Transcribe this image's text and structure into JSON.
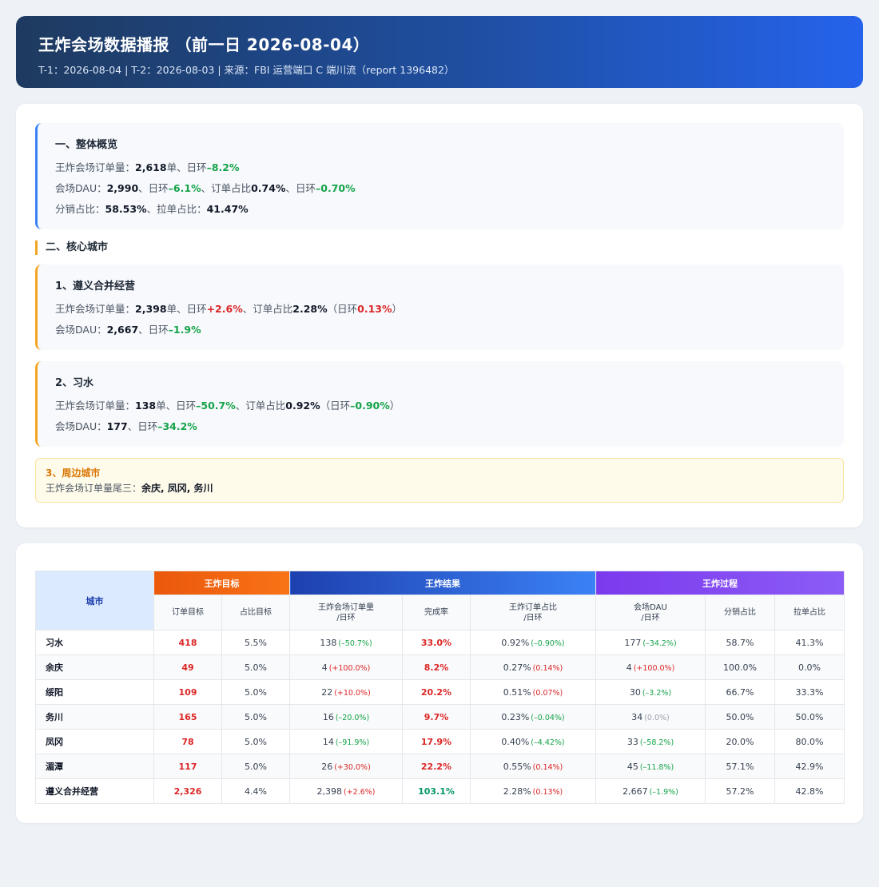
{
  "header": {
    "title": "王炸会场数据播报 （前一日 2026-08-04）",
    "subtitle": "T-1：2026-08-04 | T-2：2026-08-03 | 来源：FBI 运营端口 C 端川流（report 1396482）"
  },
  "overview": {
    "title": "一、整体概览",
    "orders_label": "王炸会场订单量：",
    "orders_value": "2,618",
    "orders_unit": "单、日环",
    "orders_change": "–8.2%",
    "dau_label": "会场DAU：",
    "dau_value": "2,990",
    "dau_sep": "、日环",
    "dau_change": "–6.1%",
    "share_label": "、订单占比",
    "share_value": "0.74%",
    "share_sep": "、日环",
    "share_change": "–0.70%",
    "dist_label": "分销占比：",
    "dist_value": "58.53%",
    "pull_label": "、拉单占比：",
    "pull_value": "41.47%"
  },
  "core": {
    "title": "二、核心城市",
    "c1": {
      "title": "1、遵义合并经营",
      "orders_label": "王炸会场订单量：",
      "orders_value": "2,398",
      "orders_unit": "单、日环",
      "orders_change": "+2.6%",
      "share_label": "、订单占比",
      "share_value": "2.28%",
      "share_open": "（日环",
      "share_change": "0.13%",
      "share_close": "）",
      "dau_label": "会场DAU：",
      "dau_value": "2,667",
      "dau_sep": "、日环",
      "dau_change": "–1.9%"
    },
    "c2": {
      "title": "2、习水",
      "orders_label": "王炸会场订单量：",
      "orders_value": "138",
      "orders_unit": "单、日环",
      "orders_change": "–50.7%",
      "share_label": "、订单占比",
      "share_value": "0.92%",
      "share_open": "（日环",
      "share_change": "–0.90%",
      "share_close": "）",
      "dau_label": "会场DAU：",
      "dau_value": "177",
      "dau_sep": "、日环",
      "dau_change": "–34.2%"
    },
    "c3": {
      "title": "3、周边城市",
      "label": "王炸会场订单量尾三：",
      "value": "余庆, 凤冈, 务川"
    }
  },
  "table": {
    "city_header": "城市",
    "groups": [
      "王炸目标",
      "王炸结果",
      "王炸过程"
    ],
    "columns": [
      "订单目标",
      "占比目标",
      "王炸会场订单量",
      "/日环",
      "完成率",
      "王炸订单占比",
      "/日环",
      "会场DAU",
      "/日环",
      "分销占比",
      "拉单占比"
    ],
    "rows": [
      {
        "city": "习水",
        "target": "418",
        "share_target": "5.5%",
        "orders": "138",
        "orders_ch": "(–50.7%)",
        "orders_dir": "down",
        "rate": "33.0%",
        "rate_ok": false,
        "share": "0.92%",
        "share_ch": "(–0.90%)",
        "share_dir": "down",
        "dau": "177",
        "dau_ch": "(–34.2%)",
        "dau_dir": "down",
        "dist": "58.7%",
        "pull": "41.3%"
      },
      {
        "city": "余庆",
        "target": "49",
        "share_target": "5.0%",
        "orders": "4",
        "orders_ch": "(+100.0%)",
        "orders_dir": "up",
        "rate": "8.2%",
        "rate_ok": false,
        "share": "0.27%",
        "share_ch": "(0.14%)",
        "share_dir": "up",
        "dau": "4",
        "dau_ch": "(+100.0%)",
        "dau_dir": "up",
        "dist": "100.0%",
        "pull": "0.0%"
      },
      {
        "city": "绥阳",
        "target": "109",
        "share_target": "5.0%",
        "orders": "22",
        "orders_ch": "(+10.0%)",
        "orders_dir": "up",
        "rate": "20.2%",
        "rate_ok": false,
        "share": "0.51%",
        "share_ch": "(0.07%)",
        "share_dir": "up",
        "dau": "30",
        "dau_ch": "(–3.2%)",
        "dau_dir": "down",
        "dist": "66.7%",
        "pull": "33.3%"
      },
      {
        "city": "务川",
        "target": "165",
        "share_target": "5.0%",
        "orders": "16",
        "orders_ch": "(–20.0%)",
        "orders_dir": "down",
        "rate": "9.7%",
        "rate_ok": false,
        "share": "0.23%",
        "share_ch": "(–0.04%)",
        "share_dir": "down",
        "dau": "34",
        "dau_ch": "(0.0%)",
        "dau_dir": "flat",
        "dist": "50.0%",
        "pull": "50.0%"
      },
      {
        "city": "凤冈",
        "target": "78",
        "share_target": "5.0%",
        "orders": "14",
        "orders_ch": "(–91.9%)",
        "orders_dir": "down",
        "rate": "17.9%",
        "rate_ok": false,
        "share": "0.40%",
        "share_ch": "(–4.42%)",
        "share_dir": "down",
        "dau": "33",
        "dau_ch": "(–58.2%)",
        "dau_dir": "down",
        "dist": "20.0%",
        "pull": "80.0%"
      },
      {
        "city": "湄潭",
        "target": "117",
        "share_target": "5.0%",
        "orders": "26",
        "orders_ch": "(+30.0%)",
        "orders_dir": "up",
        "rate": "22.2%",
        "rate_ok": false,
        "share": "0.55%",
        "share_ch": "(0.14%)",
        "share_dir": "up",
        "dau": "45",
        "dau_ch": "(–11.8%)",
        "dau_dir": "down",
        "dist": "57.1%",
        "pull": "42.9%"
      },
      {
        "city": "遵义合并经营",
        "target": "2,326",
        "share_target": "4.4%",
        "orders": "2,398",
        "orders_ch": "(+2.6%)",
        "orders_dir": "up",
        "rate": "103.1%",
        "rate_ok": true,
        "share": "2.28%",
        "share_ch": "(0.13%)",
        "share_dir": "up",
        "dau": "2,667",
        "dau_ch": "(–1.9%)",
        "dau_dir": "down",
        "dist": "57.2%",
        "pull": "42.8%"
      }
    ]
  }
}
